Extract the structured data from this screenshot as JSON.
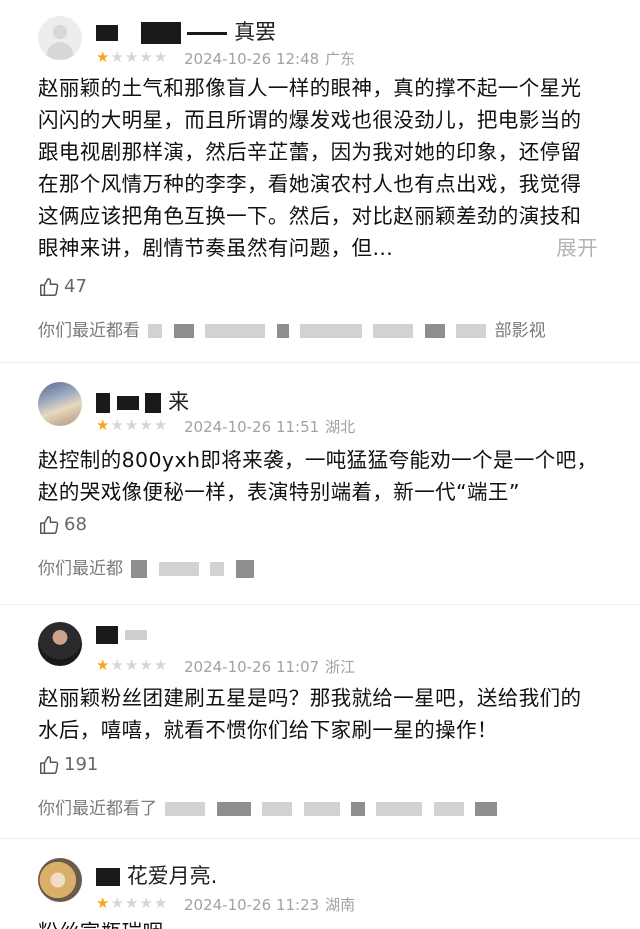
{
  "reviews": [
    {
      "nickname_suffix": "真罢",
      "stars_filled": 1,
      "stars_total": 5,
      "date": "2024-10-26 12:48",
      "location": "广东",
      "text": "赵丽颖的土气和那像盲人一样的眼神，真的撑不起一个星光闪闪的大明星，而且所谓的爆发戏也很没劲儿，把电影当的跟电视剧那样演，然后辛芷蕾，因为我对她的印象，还停留在那个风情万种的李李，看她演农村人也有点出戏，我觉得这俩应该把角色互换一下。然后，对比赵丽颖差劲的演技和眼神来讲，剧情节奏虽然有问题，但…",
      "more": "展开",
      "likes": "47",
      "watched_prefix": "你们最近都看",
      "watched_suffix": "部影视",
      "avatar": "default-avatar-icon"
    },
    {
      "nickname_suffix": "来",
      "stars_filled": 1,
      "stars_total": 5,
      "date": "2024-10-26 11:51",
      "location": "湖北",
      "text": "赵控制的800yxh即将来袭，一吨猛猛夸能劝一个是一个吧，赵的哭戏像便秘一样，表演特别端着，新一代“端王”",
      "likes": "68",
      "watched_prefix": "你们最近都",
      "avatar": "sky-avatar"
    },
    {
      "nickname_suffix": "",
      "stars_filled": 1,
      "stars_total": 5,
      "date": "2024-10-26 11:07",
      "location": "浙江",
      "text": "赵丽颖粉丝团建刷五星是吗？那我就给一星吧，送给我们的水后，嘻嘻，就看不惯你们给下家刷一星的操作！",
      "likes": "191",
      "watched_prefix": "你们最近都看了",
      "avatar": "dark-avatar"
    },
    {
      "nickname_suffix": "花爱月亮.",
      "stars_filled": 1,
      "stars_total": 5,
      "date": "2024-10-26 11:23",
      "location": "湖南",
      "text": "粉丝宣瓶瑞咽 ",
      "avatar": "blond-avatar"
    }
  ],
  "icons": {
    "like": "thumbs-up-icon",
    "star": "star-icon"
  },
  "colors": {
    "star_on": "#f5a623",
    "star_off": "#d6d6d6",
    "meta": "#a2a2a2",
    "more": "#b3b3b3"
  }
}
